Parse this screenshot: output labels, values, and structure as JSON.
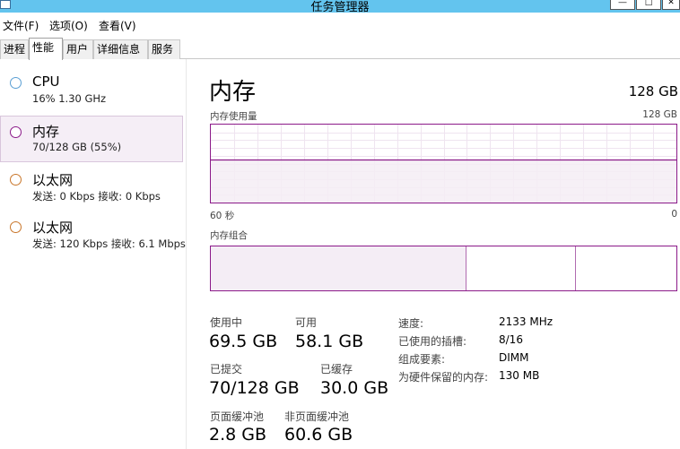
{
  "window": {
    "title": "任务管理器"
  },
  "menu": [
    {
      "label": "文件(F)"
    },
    {
      "label": "选项(O)"
    },
    {
      "label": "查看(V)"
    }
  ],
  "tabs": [
    {
      "label": "进程",
      "active": false
    },
    {
      "label": "性能",
      "active": true
    },
    {
      "label": "用户",
      "active": false
    },
    {
      "label": "详细信息",
      "active": false
    },
    {
      "label": "服务",
      "active": false
    }
  ],
  "sidebar": {
    "items": [
      {
        "title": "CPU",
        "subtitle": "16% 1.30 GHz",
        "ring_color": "#5a9fd4",
        "selected": false
      },
      {
        "title": "内存",
        "subtitle": "70/128 GB (55%)",
        "ring_color": "#8b1a89",
        "selected": true
      },
      {
        "title": "以太网",
        "subtitle": "发送: 0 Kbps 接收: 0 Kbps",
        "ring_color": "#c9762a",
        "selected": false
      },
      {
        "title": "以太网",
        "subtitle": "发送: 120 Kbps 接收: 6.1 Mbps",
        "ring_color": "#c9762a",
        "selected": false
      }
    ]
  },
  "main": {
    "title": "内存",
    "total": "128 GB",
    "usage_graph": {
      "label": "内存使用量",
      "max_label": "128 GB",
      "time_left": "60 秒",
      "time_right": "0",
      "usage_fraction": 0.55,
      "line_color": "#8b1a89",
      "fill_color": "#f4edf5"
    },
    "composition": {
      "label": "内存组合",
      "segments": [
        {
          "fraction": 0.55,
          "fill": "#f4edf5"
        },
        {
          "fraction": 0.235,
          "fill": "#ffffff"
        },
        {
          "fraction": 0.215,
          "fill": "#ffffff"
        }
      ]
    },
    "stats": {
      "in_use": {
        "label": "使用中",
        "value": "69.5 GB"
      },
      "available": {
        "label": "可用",
        "value": "58.1 GB"
      },
      "committed": {
        "label": "已提交",
        "value": "70/128 GB"
      },
      "cached": {
        "label": "已缓存",
        "value": "30.0 GB"
      },
      "paged_pool": {
        "label": "页面缓冲池",
        "value": "2.8 GB"
      },
      "nonpaged_pool": {
        "label": "非页面缓冲池",
        "value": "60.6 GB"
      }
    },
    "details": [
      {
        "key": "速度:",
        "value": "2133 MHz"
      },
      {
        "key": "已使用的插槽:",
        "value": "8/16"
      },
      {
        "key": "组成要素:",
        "value": "DIMM"
      },
      {
        "key": "为硬件保留的内存:",
        "value": "130 MB"
      }
    ]
  }
}
